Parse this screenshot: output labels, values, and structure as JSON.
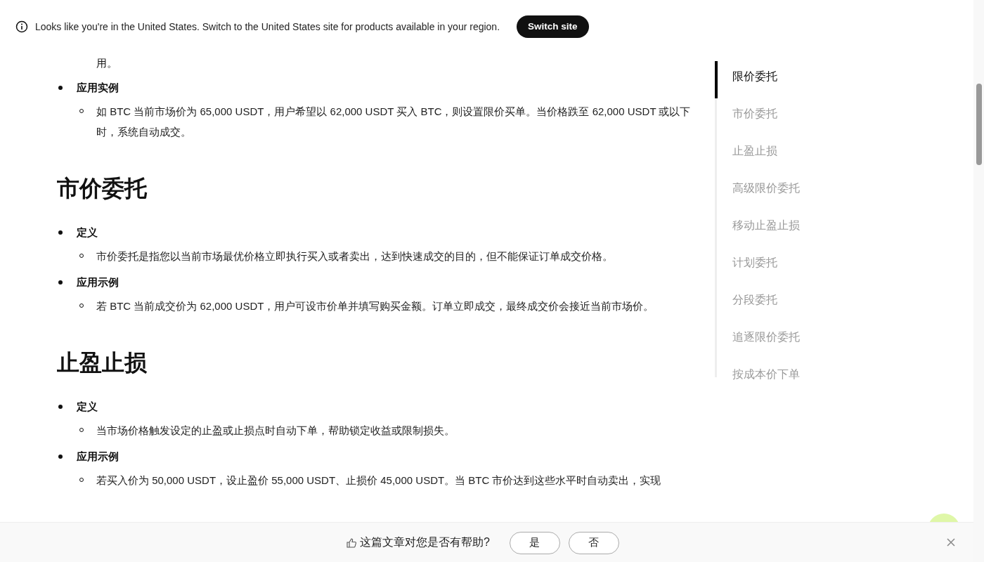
{
  "banner": {
    "message": "Looks like you're in the United States. Switch to the United States site for products available in your region.",
    "button": "Switch site"
  },
  "article": {
    "sections": [
      {
        "items": [
          {
            "kind": "continuation",
            "text": "用。"
          },
          {
            "kind": "label",
            "text": "应用实例"
          },
          {
            "kind": "detail",
            "text": "如 BTC 当前市场价为 65,000 USDT，用户希望以 62,000 USDT 买入 BTC，则设置限价买单。当价格跌至 62,000 USDT 或以下时，系统自动成交。"
          }
        ]
      },
      {
        "heading": "市价委托",
        "items": [
          {
            "kind": "label",
            "text": "定义"
          },
          {
            "kind": "detail",
            "text": "市价委托是指您以当前市场最优价格立即执行买入或者卖出，达到快速成交的目的，但不能保证订单成交价格。"
          },
          {
            "kind": "label",
            "text": "应用示例"
          },
          {
            "kind": "detail",
            "text": "若 BTC 当前成交价为 62,000 USDT，用户可设市价单并填写购买金额。订单立即成交，最终成交价会接近当前市场价。"
          }
        ]
      },
      {
        "heading": "止盈止损",
        "items": [
          {
            "kind": "label",
            "text": "定义"
          },
          {
            "kind": "detail",
            "text": "当市场价格触发设定的止盈或止损点时自动下单，帮助锁定收益或限制损失。"
          },
          {
            "kind": "label",
            "text": "应用示例"
          },
          {
            "kind": "detail",
            "text": "若买入价为 50,000 USDT，设止盈价 55,000 USDT、止损价 45,000 USDT。当 BTC 市价达到这些水平时自动卖出，实现"
          }
        ]
      }
    ]
  },
  "toc": [
    {
      "label": "限价委托",
      "selected": true
    },
    {
      "label": "市价委托",
      "selected": false
    },
    {
      "label": "止盈止损",
      "selected": false
    },
    {
      "label": "高级限价委托",
      "selected": false
    },
    {
      "label": "移动止盈止损",
      "selected": false
    },
    {
      "label": "计划委托",
      "selected": false
    },
    {
      "label": "分段委托",
      "selected": false
    },
    {
      "label": "追逐限价委托",
      "selected": false
    },
    {
      "label": "按成本价下单",
      "selected": false
    }
  ],
  "feedback": {
    "question": "这篇文章对您是否有帮助?",
    "buttons": [
      "是",
      "否"
    ]
  }
}
